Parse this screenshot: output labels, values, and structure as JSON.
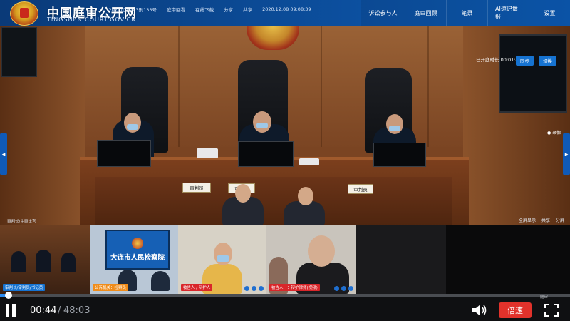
{
  "header": {
    "site_title": "中国庭审公开网",
    "site_url": "TINGSHEN.COURT.GOV.CN",
    "case_info": [
      "(2020)辽0203刑133号",
      "庭审回看",
      "在线下载",
      "分享",
      "共享",
      "2020.12.08 09:08:39"
    ],
    "nav": [
      "诉讼参与人",
      "庭审回顾",
      "笔录",
      "AI速记播报",
      "设置"
    ]
  },
  "main_video": {
    "duration_label": "已开庭时长 00:01:49",
    "buttons": [
      "同步",
      "切换"
    ],
    "nameplates": [
      "审判员",
      "审判长",
      "审判员"
    ],
    "overlay_left": "审判长/主审法官",
    "controls": [
      "全屏显示",
      "共享",
      "分屏"
    ],
    "rec_label": "录像"
  },
  "tiles": [
    {
      "label": "审判长/审判员/书记员",
      "color": "#1673d1"
    },
    {
      "label": "公诉机关：检察员",
      "color": "#f08c1a",
      "screen_title": "大连市人民检察院"
    },
    {
      "label": "被告人 / 辩护人",
      "color": "#d9262a"
    },
    {
      "label": "被告人一：辩护律师(视频)",
      "color": "#d9262a"
    },
    {
      "label": "",
      "color": "#1a1a1c"
    },
    {
      "label": "",
      "color": "#0a0a0b"
    }
  ],
  "player": {
    "current_time": "00:44",
    "separator": "/",
    "total_time": "48:03",
    "progress": 0.0153,
    "speed_label": "倍速",
    "player_tag": "庭审"
  }
}
